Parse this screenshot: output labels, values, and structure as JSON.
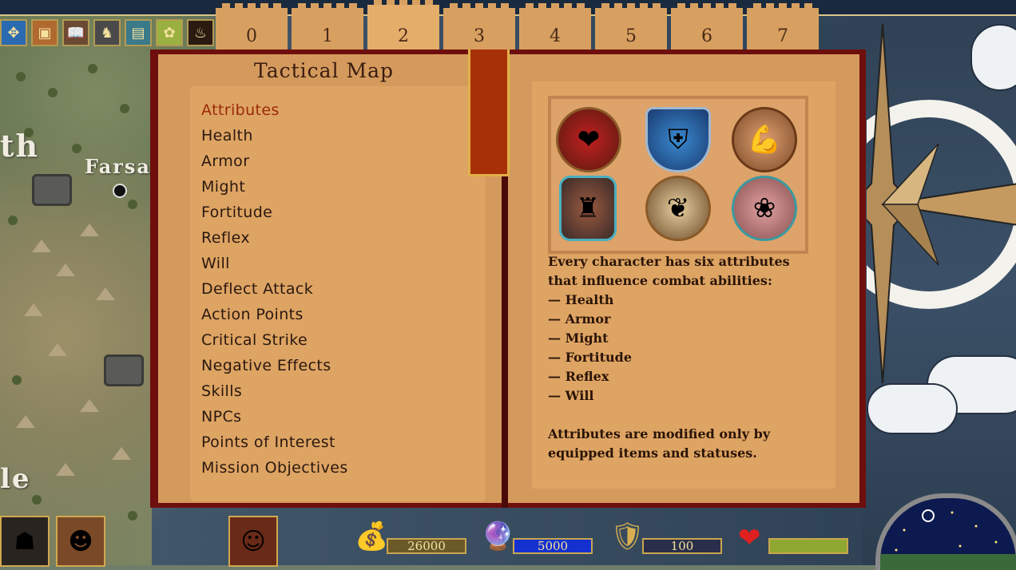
{
  "book": {
    "title": "Tactical Map",
    "tabs": [
      "0",
      "1",
      "2",
      "3",
      "4",
      "5",
      "6",
      "7"
    ],
    "active_tab": "2",
    "toc": [
      "Attributes",
      "Health",
      "Armor",
      "Might",
      "Fortitude",
      "Reflex",
      "Will",
      "Deflect Attack",
      "Action Points",
      "Critical Strike",
      "Negative Effects",
      "Skills",
      "NPCs",
      "Points of Interest",
      "Mission Objectives"
    ],
    "active_entry": "Attributes",
    "description": {
      "intro": "Every character has six attributes that influence combat abilities:",
      "items": [
        "— Health",
        "— Armor",
        "— Might",
        "— Fortitude",
        "— Reflex",
        "— Will"
      ],
      "outro": "Attributes are modified only by equipped items and statuses."
    },
    "attribute_icons": [
      "heart-icon",
      "shield-icon",
      "muscle-arm-icon",
      "torso-icon",
      "winged-feet-icon",
      "brain-icon"
    ]
  },
  "map": {
    "labels": [
      "th",
      "Farsa",
      "le"
    ]
  },
  "hud": {
    "gold": "26000",
    "mana": "5000",
    "glory": "100",
    "colors": {
      "gold_bar": "#8a6a28",
      "mana_bar": "#1530d0",
      "glory_bar": "#2a2e4a",
      "health_bar": "#8fa832"
    }
  }
}
